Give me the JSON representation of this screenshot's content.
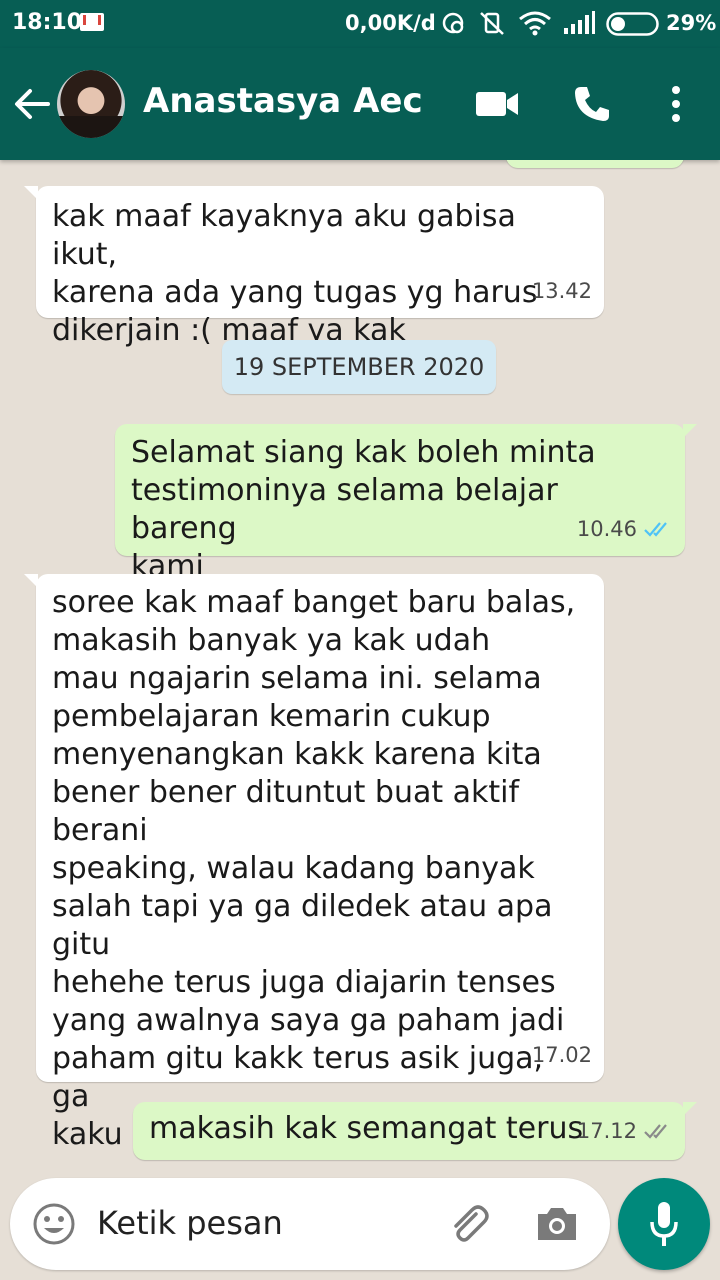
{
  "status_bar": {
    "time": "18:10",
    "net_speed": "0,00K/d",
    "battery": "29%"
  },
  "header": {
    "contact_name": "Anastasya Aec"
  },
  "messages": [
    {
      "direction": "in",
      "text": "kak maaf kayaknya aku gabisa ikut,\nkarena ada yang tugas yg harus\ndikerjain :( maaf ya kak",
      "time": "13.42"
    },
    {
      "direction": "out",
      "text": "Selamat siang kak boleh minta\ntestimoninya selama belajar bareng\nkami",
      "time": "10.46",
      "status": "read"
    },
    {
      "direction": "in",
      "text": "soree kak maaf banget baru balas,\nmakasih banyak ya kak udah\nmau ngajarin selama ini. selama\npembelajaran kemarin cukup\nmenyenangkan kakk karena kita\nbener bener dituntut buat aktif berani\nspeaking, walau kadang banyak\nsalah tapi ya ga diledek atau apa gitu\nhehehe terus juga diajarin tenses\nyang awalnya saya ga paham jadi\npaham gitu kakk terus asik juga, ga\nkaku gitu, makasih banyak kakk!!",
      "time": "17.02"
    },
    {
      "direction": "out",
      "text": "makasih kak semangat terus",
      "time": "17.12",
      "status": "delivered"
    }
  ],
  "date_chip": "19 SEPTEMBER 2020",
  "composer": {
    "placeholder": "Ketik pesan"
  },
  "colors": {
    "header": "#075e54",
    "outgoing": "#dcf8c6",
    "incoming": "#ffffff",
    "read_ticks": "#4fc3f7",
    "mic": "#00897b"
  }
}
